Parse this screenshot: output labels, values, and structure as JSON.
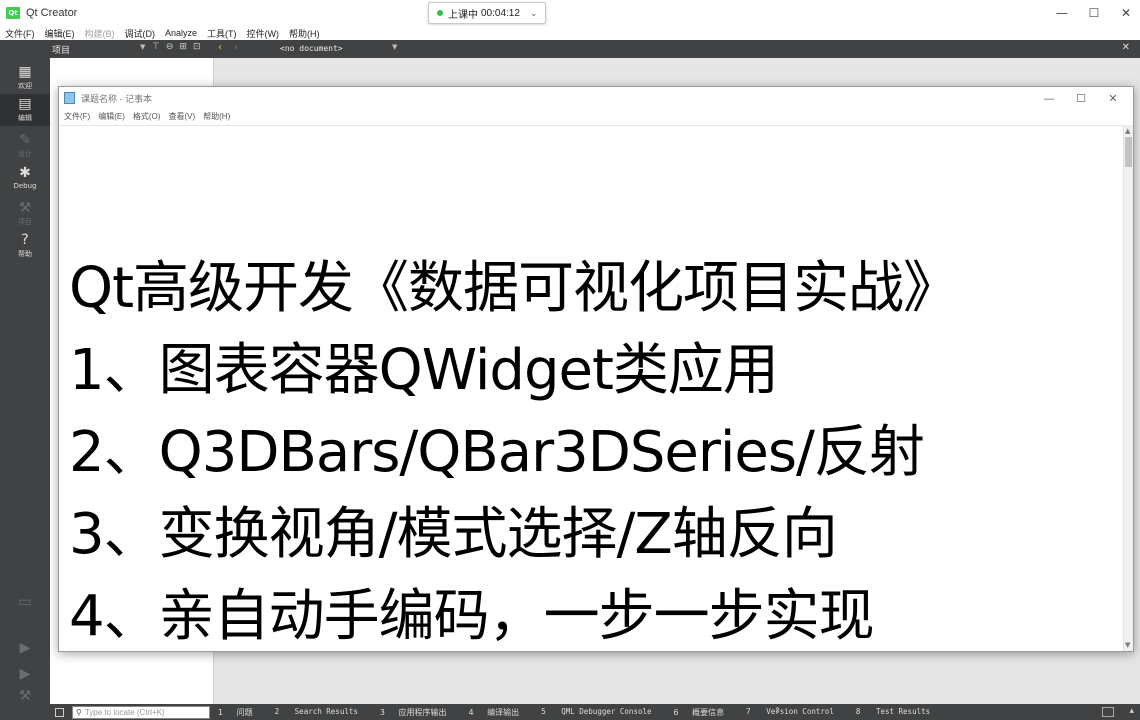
{
  "qt_window": {
    "title": "Qt Creator",
    "logo_text": "Qt",
    "timer": {
      "status": "上课中",
      "time": "00:04:12",
      "expand_icon": "chevron-down-icon"
    },
    "controls": [
      "—",
      "☐",
      "✕"
    ]
  },
  "qt_menu": [
    {
      "label": "文件(F)",
      "enabled": true
    },
    {
      "label": "编辑(E)",
      "enabled": true
    },
    {
      "label": "构建(B)",
      "enabled": false
    },
    {
      "label": "调试(D)",
      "enabled": true
    },
    {
      "label": "Analyze",
      "enabled": true
    },
    {
      "label": "工具(T)",
      "enabled": true
    },
    {
      "label": "控件(W)",
      "enabled": true
    },
    {
      "label": "帮助(H)",
      "enabled": true
    }
  ],
  "qt_toolbar": {
    "project_label": "项目",
    "document_label": "<no document>"
  },
  "modes": [
    {
      "label": "欢迎",
      "icon": "grid-icon",
      "active": false,
      "enabled": true
    },
    {
      "label": "编辑",
      "icon": "edit-icon",
      "active": true,
      "enabled": true
    },
    {
      "label": "设计",
      "icon": "pen-icon",
      "active": false,
      "enabled": false
    },
    {
      "label": "Debug",
      "icon": "bug-icon",
      "active": false,
      "enabled": true
    },
    {
      "label": "项目",
      "icon": "wrench-icon",
      "active": false,
      "enabled": false
    },
    {
      "label": "帮助",
      "icon": "help-icon",
      "active": false,
      "enabled": true
    }
  ],
  "statusbar": {
    "locator_placeholder": "Type to locate (Ctrl+K)",
    "tabs": [
      {
        "num": "1",
        "label": "问题"
      },
      {
        "num": "2",
        "label": "Search Results"
      },
      {
        "num": "3",
        "label": "应用程序输出"
      },
      {
        "num": "4",
        "label": "编译输出"
      },
      {
        "num": "5",
        "label": "QML Debugger Console"
      },
      {
        "num": "6",
        "label": "概要信息"
      },
      {
        "num": "7",
        "label": "Version Control"
      },
      {
        "num": "8",
        "label": "Test Results"
      }
    ]
  },
  "notepad": {
    "title": "课题名称 - 记事本",
    "menu": [
      "文件(F)",
      "编辑(E)",
      "格式(O)",
      "查看(V)",
      "帮助(H)"
    ],
    "lines": [
      "Qt高级开发《数据可视化项目实战》",
      "1、图表容器QWidget类应用",
      "2、Q3DBars/QBar3DSeries/反射",
      "3、变换视角/模式选择/Z轴反向",
      "4、亲自动手编码，一步一步实现"
    ]
  },
  "colors": {
    "qt_dark": "#404244",
    "qt_active_mode": "#2f3133",
    "editor_bg": "#e6e6e6",
    "timer_dot": "#2fbf4a",
    "qt_green": "#41cd52"
  }
}
